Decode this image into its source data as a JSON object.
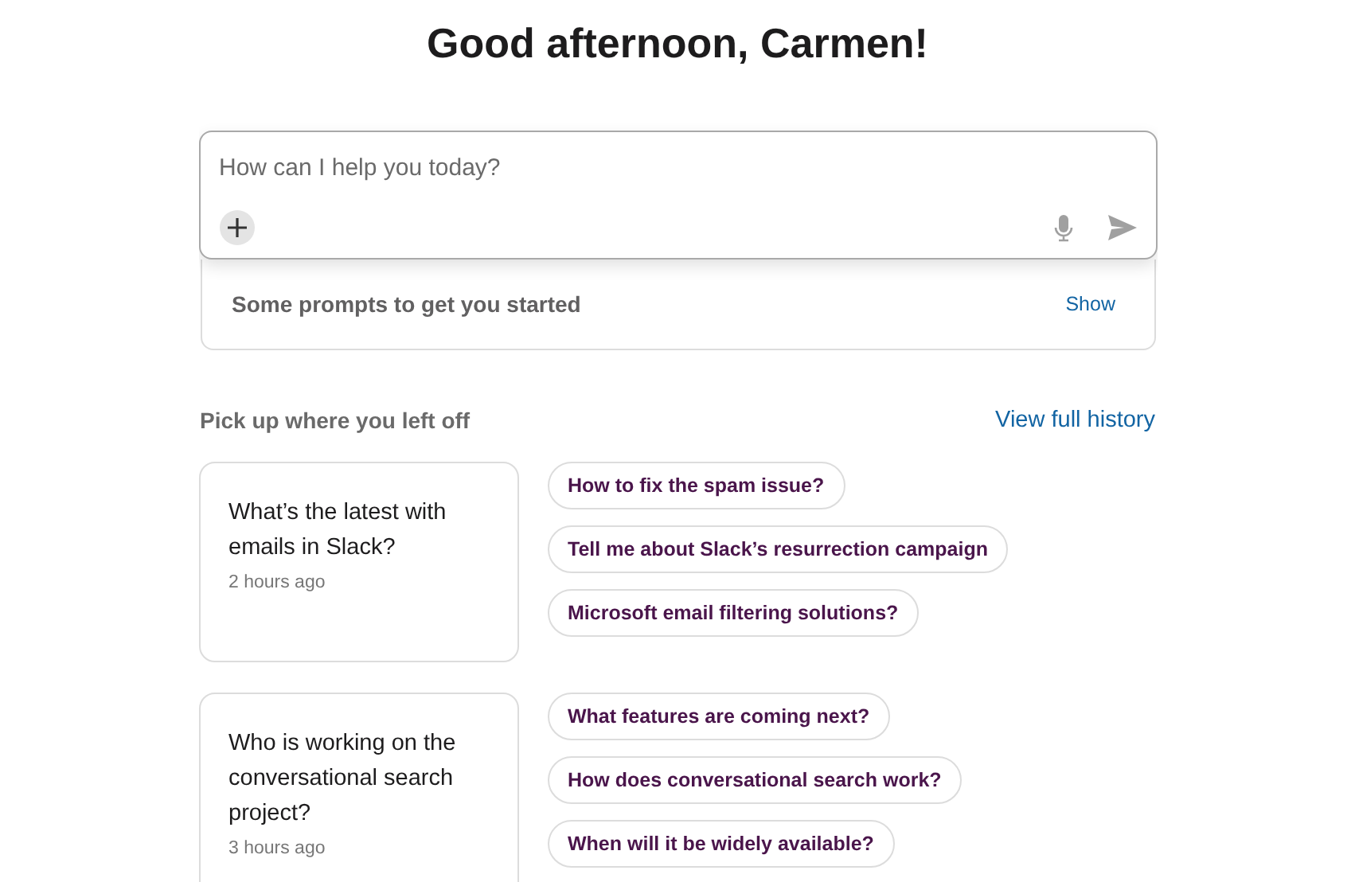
{
  "greeting": "Good afternoon, Carmen!",
  "composer": {
    "placeholder": "How can I help you today?"
  },
  "prompts": {
    "label": "Some prompts to get you started",
    "toggle": "Show"
  },
  "history": {
    "title": "Pick up where you left off",
    "link": "View full history",
    "items": [
      {
        "question": "What’s the latest with emails in Slack?",
        "time": "2 hours ago",
        "followups": [
          "How to fix the spam issue?",
          "Tell me about Slack’s resurrection campaign",
          "Microsoft email filtering solutions?"
        ]
      },
      {
        "question": "Who is working on the conversational search project?",
        "time": "3 hours ago",
        "followups": [
          "What features are coming next?",
          "How does conversational search work?",
          "When will it be widely available?"
        ]
      }
    ]
  }
}
